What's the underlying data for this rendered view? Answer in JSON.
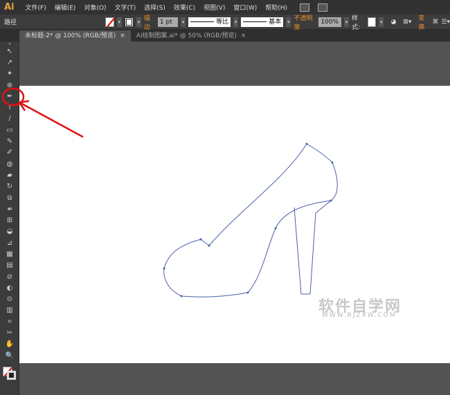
{
  "app": {
    "logo": "Ai"
  },
  "menu": [
    "文件(F)",
    "编辑(E)",
    "对象(O)",
    "文字(T)",
    "选择(S)",
    "效果(C)",
    "视图(V)",
    "窗口(W)",
    "帮助(H)"
  ],
  "control": {
    "selection_label": "路径",
    "stroke_label": "描边",
    "stroke_weight": "1 pt",
    "profile1": "等比",
    "profile2": "基本",
    "opacity_label": "不透明度",
    "opacity": "100%",
    "style_label": "样式:",
    "transform_label": "变换"
  },
  "tabs": [
    {
      "label": "未标题-2* @ 100% (RGB/预览)",
      "close": "×"
    },
    {
      "label": "Ai绘制图案.ai* @ 50% (RGB/预览)",
      "close": "×"
    }
  ],
  "tools": [
    "↖",
    "↗",
    "✦",
    "⊕",
    "✒",
    "T",
    "/",
    "▭",
    "✎",
    "✐",
    "◍",
    "▰",
    "↻",
    "⧉",
    "☙",
    "⊞",
    "◒",
    "⊿",
    "▦",
    "▤",
    "⊘",
    "◐",
    "⊙",
    "▥",
    "⌗",
    "✂",
    "✋",
    "🔍"
  ],
  "watermark": {
    "title": "软件自学网",
    "url": "WWW.RJZXW.COM"
  },
  "colors": {
    "annotation": "#dd1111",
    "path": "#4a5fa8"
  }
}
